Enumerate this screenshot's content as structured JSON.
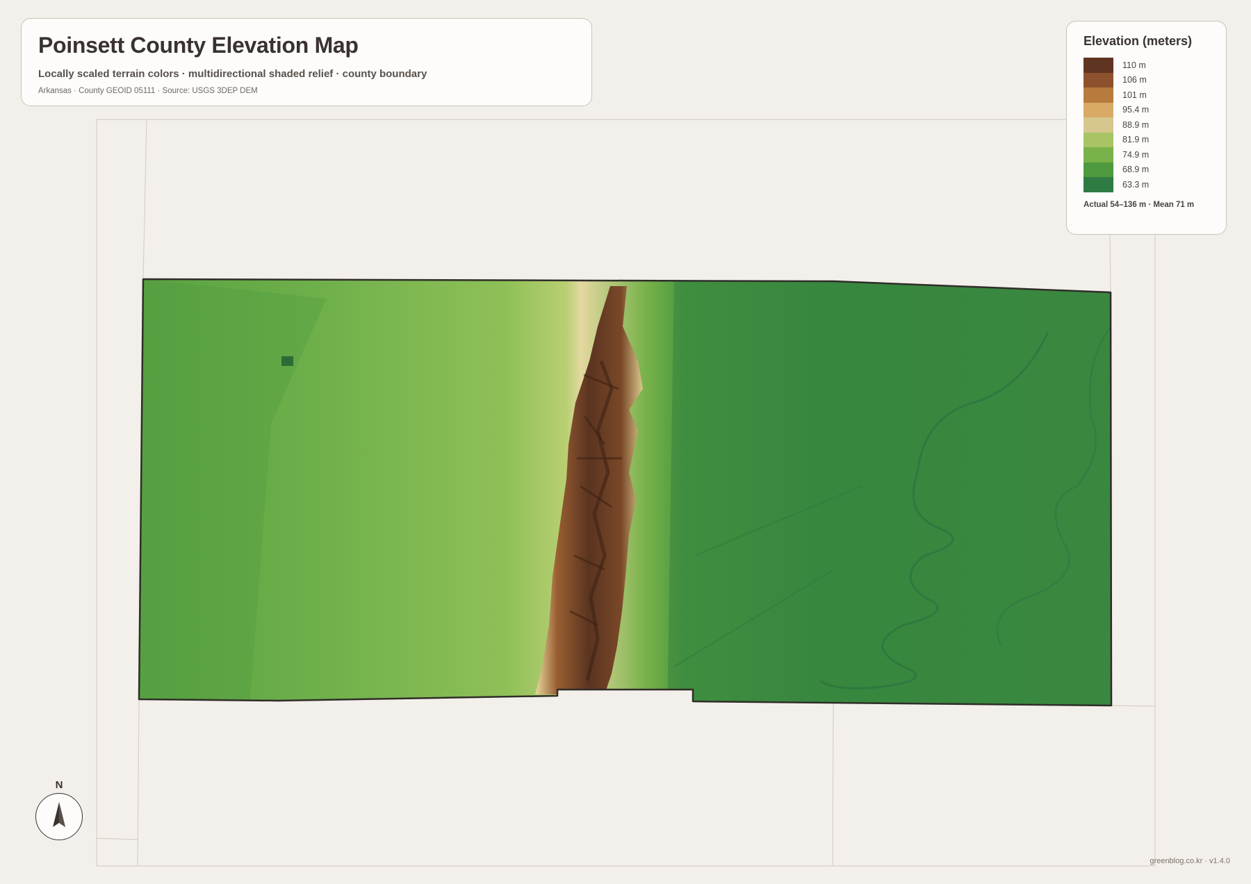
{
  "header": {
    "title": "Poinsett County Elevation Map",
    "subtitle": "Locally scaled terrain colors · multidirectional shaded relief · county boundary",
    "source": "Arkansas · County GEOID 05111 · Source: USGS 3DEP DEM"
  },
  "legend": {
    "title": "Elevation (meters)",
    "items": [
      {
        "label": "110 m",
        "color": "#5f3522"
      },
      {
        "label": "106 m",
        "color": "#8d522d"
      },
      {
        "label": "101 m",
        "color": "#b87b3e"
      },
      {
        "label": "95.4 m",
        "color": "#d9aa66"
      },
      {
        "label": "88.9 m",
        "color": "#d5c78d"
      },
      {
        "label": "81.9 m",
        "color": "#a9c464"
      },
      {
        "label": "74.9 m",
        "color": "#79b24a"
      },
      {
        "label": "68.9 m",
        "color": "#4f9a3e"
      },
      {
        "label": "63.3 m",
        "color": "#2e7c43"
      }
    ],
    "footer": "Actual 54–136 m · Mean 71 m"
  },
  "compass": {
    "label": "N"
  },
  "credit": "greenblog.co.kr · v1.4.0",
  "colors": {
    "background": "#f3f0eb",
    "lowland": "#3b8a3e",
    "plain_west": "#6fae48",
    "ridge_dark": "#5a3420",
    "boundary": "#2f2d28"
  }
}
